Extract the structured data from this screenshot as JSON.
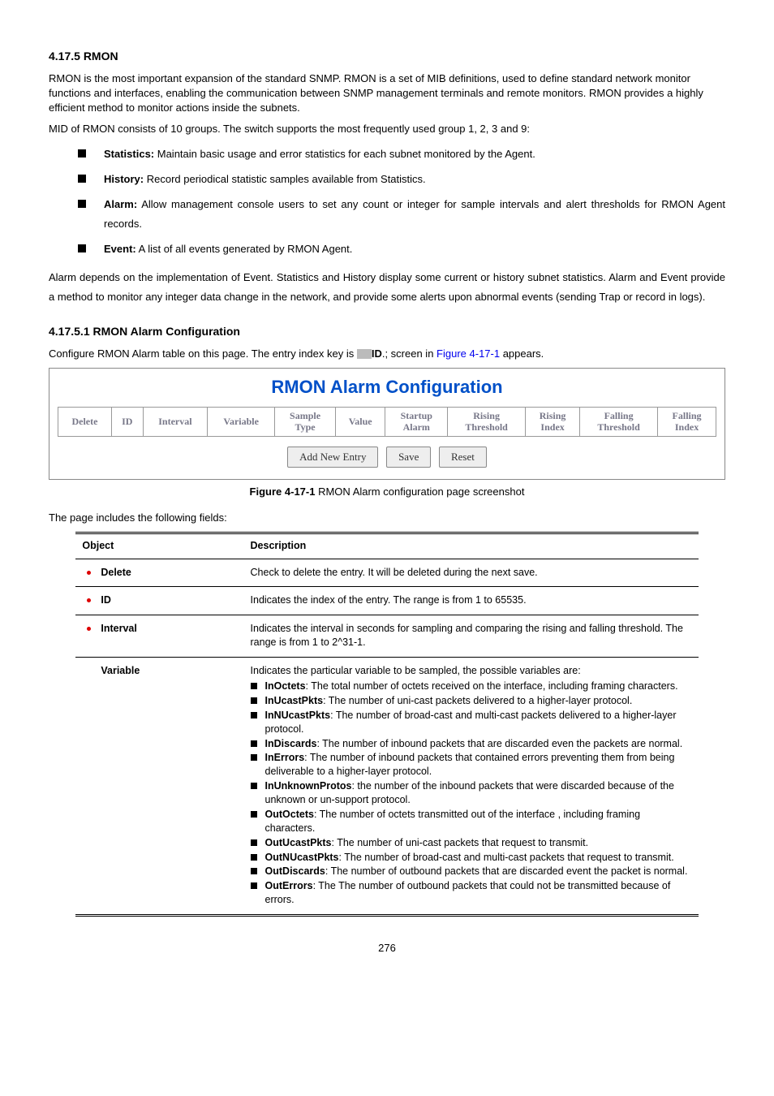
{
  "section1_title": "4.17.5 RMON",
  "intro_p1": "RMON is the most important expansion of the standard SNMP. RMON is a set of MIB definitions, used to define standard network monitor functions and interfaces, enabling the communication between SNMP management terminals and remote monitors. RMON provides a highly efficient method to monitor actions inside the subnets.",
  "intro_p2": "MID of RMON consists of 10 groups. The switch supports the most frequently used group 1, 2, 3 and 9:",
  "groups": [
    {
      "name": "Statistics:",
      "desc": " Maintain basic usage and error statistics for each subnet monitored by the Agent."
    },
    {
      "name": "History:",
      "desc": " Record periodical statistic samples available from Statistics."
    },
    {
      "name": "Alarm:",
      "desc": " Allow management console users to set any count or integer for sample intervals and alert thresholds for RMON Agent records."
    },
    {
      "name": "Event:",
      "desc": " A list of all events generated by RMON Agent."
    }
  ],
  "intro_p3": "Alarm depends on the implementation of Event. Statistics and History display some current or history subnet statistics. Alarm and Event provide a method to monitor any integer data change in the network, and provide some alerts upon abnormal events (sending Trap or record in logs).",
  "section2_title": "4.17.5.1 RMON Alarm Configuration",
  "config_sentence_a": "Configure RMON Alarm table on this page. The entry index key is ",
  "config_sentence_b": "ID",
  "config_sentence_c": ".; screen in ",
  "config_sentence_link": "Figure 4-17-1",
  "config_sentence_d": " appears.",
  "figure": {
    "heading": "RMON Alarm Configuration",
    "headers": [
      "Delete",
      "ID",
      "Interval",
      "Variable",
      "Sample Type",
      "Value",
      "Startup Alarm",
      "Rising Threshold",
      "Rising Index",
      "Falling Threshold",
      "Falling Index"
    ],
    "buttons": [
      "Add New Entry",
      "Save",
      "Reset"
    ],
    "caption_a": "Figure 4-17-1",
    "caption_b": " RMON Alarm configuration page screenshot"
  },
  "fields_intro": "The page includes the following fields:",
  "fields_table": {
    "head_left": "Object",
    "head_right": "Description",
    "rows": [
      {
        "left": "Delete",
        "bullet": true,
        "right_text": "Check to delete the entry. It will be deleted during the next save."
      },
      {
        "left": "ID",
        "bullet": true,
        "right_text": "Indicates the index of the entry. The range is from 1 to 65535."
      },
      {
        "left": "Interval",
        "bullet": true,
        "right_text": "Indicates the interval in seconds for sampling and comparing the rising and falling threshold. The range is from 1 to 2^31-1."
      }
    ],
    "variable_row": {
      "left": "Variable",
      "lead": "Indicates the particular variable to be sampled, the possible variables are:",
      "items": [
        {
          "name": "InOctets",
          "desc": ": The total number of octets received on the interface, including framing characters."
        },
        {
          "name": "InUcastPkts",
          "desc": ": The number of uni-cast packets delivered to a higher-layer protocol."
        },
        {
          "name": "InNUcastPkts",
          "desc": ": The number of broad-cast and multi-cast packets delivered to a higher-layer protocol."
        },
        {
          "name": "InDiscards",
          "desc": ": The number of inbound packets that are discarded even the packets are normal."
        },
        {
          "name": "InErrors",
          "desc": ": The number of inbound packets that contained errors preventing them from being deliverable to a higher-layer protocol."
        },
        {
          "name": "InUnknownProtos",
          "desc": ": the number of the inbound packets that were discarded because of the unknown or un-support protocol."
        },
        {
          "name": "OutOctets",
          "desc": ": The number of octets transmitted out of the interface , including framing characters."
        },
        {
          "name": "OutUcastPkts",
          "desc": ": The number of uni-cast packets that request to transmit."
        },
        {
          "name": "OutNUcastPkts",
          "desc": ": The number of broad-cast and multi-cast packets that request to transmit."
        },
        {
          "name": "OutDiscards",
          "desc": ": The number of outbound packets that are discarded event the packet is normal."
        },
        {
          "name": "OutErrors",
          "desc": ": The The number of outbound packets that could not be transmitted because of errors."
        }
      ]
    }
  },
  "page_number": "276"
}
